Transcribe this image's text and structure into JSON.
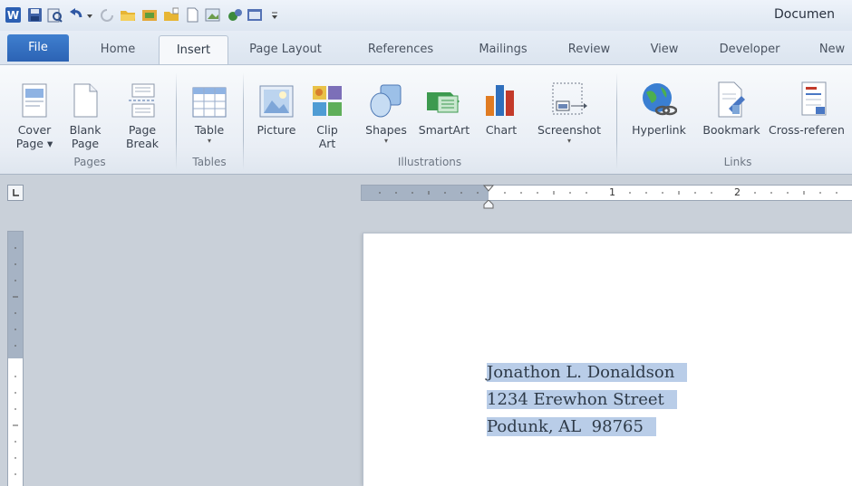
{
  "title_bar": {
    "document_title": "Documen",
    "quick_access": [
      "word-app-icon",
      "save-icon",
      "print-preview-icon",
      "undo-icon",
      "redo-icon",
      "open-folder-icon",
      "insert-picture-icon",
      "new-folder-icon",
      "blank-page-icon",
      "picture-icon",
      "tools-icon",
      "view-icon",
      "customize-icon"
    ]
  },
  "tabs": [
    {
      "label": "File"
    },
    {
      "label": "Home"
    },
    {
      "label": "Insert"
    },
    {
      "label": "Page Layout"
    },
    {
      "label": "References"
    },
    {
      "label": "Mailings"
    },
    {
      "label": "Review"
    },
    {
      "label": "View"
    },
    {
      "label": "Developer"
    },
    {
      "label": "New"
    }
  ],
  "ribbon": {
    "groups": {
      "pages": "Pages",
      "tables": "Tables",
      "illustrations": "Illustrations",
      "links": "Links"
    },
    "buttons": {
      "cover_page": {
        "line1": "Cover",
        "line2": "Page",
        "arrow": "▾"
      },
      "blank_page": {
        "line1": "Blank",
        "line2": "Page"
      },
      "page_break": {
        "line1": "Page",
        "line2": "Break"
      },
      "table": {
        "line1": "Table",
        "arrow": "▾"
      },
      "picture": {
        "line1": "Picture"
      },
      "clip_art": {
        "line1": "Clip",
        "line2": "Art"
      },
      "shapes": {
        "line1": "Shapes",
        "arrow": "▾"
      },
      "smartart": {
        "line1": "SmartArt"
      },
      "chart": {
        "line1": "Chart"
      },
      "screenshot": {
        "line1": "Screenshot",
        "arrow": "▾"
      },
      "hyperlink": {
        "line1": "Hyperlink"
      },
      "bookmark": {
        "line1": "Bookmark"
      },
      "cross_reference": {
        "line1": "Cross-referen"
      }
    }
  },
  "ruler": {
    "h_numbers": [
      "1",
      "2"
    ]
  },
  "document": {
    "lines": [
      "Jonathon L. Donaldson",
      "1234 Erewhon Street",
      "Podunk, AL  98765"
    ],
    "selection_color": "#b9cde8"
  },
  "colors": {
    "file_tab": "#2c63b4",
    "selection": "#b9cde8",
    "background": "#c9d0d9"
  }
}
